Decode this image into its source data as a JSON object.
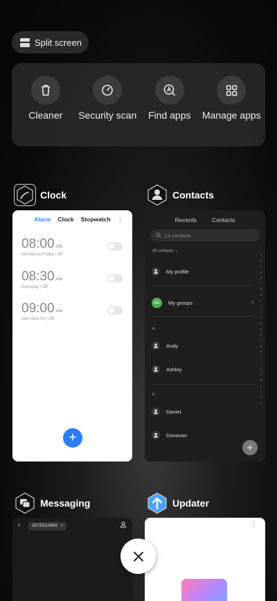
{
  "split_screen": {
    "label": "Split screen"
  },
  "quick_actions": [
    {
      "label": "Cleaner",
      "icon": "trash-icon"
    },
    {
      "label": "Security scan",
      "icon": "gauge-icon"
    },
    {
      "label": "Find apps",
      "icon": "find-apps-icon"
    },
    {
      "label": "Manage apps",
      "icon": "grid-icon"
    }
  ],
  "cards": {
    "clock": {
      "title": "Clock",
      "tabs": [
        "Alarm",
        "Clock",
        "Stopwatch"
      ],
      "alarms": [
        {
          "time": "08:00",
          "ampm": "AM",
          "desc": "Monday to Friday | Off"
        },
        {
          "time": "08:30",
          "ampm": "AM",
          "desc": "Everyday | Off"
        },
        {
          "time": "09:00",
          "ampm": "AM",
          "desc": "Mon Wed Fri | Off"
        }
      ]
    },
    "contacts": {
      "title": "Contacts",
      "tabs": [
        "Recents",
        "Contacts"
      ],
      "search_placeholder": "13 contacts",
      "all_contacts": "All contacts",
      "my_profile": "My profile",
      "my_groups": "My groups",
      "groups_badge": "MG",
      "section_a": "A",
      "section_d": "D",
      "contacts_a": [
        "Andy",
        "Ashley"
      ],
      "contacts_d": [
        "Daniel",
        "Donovan"
      ],
      "alphabet": "A B C D E F G H I J K L M N O P Q R S T U V W X Y Z #"
    },
    "messaging": {
      "title": "Messaging",
      "recipient": "18730218809"
    },
    "updater": {
      "title": "Updater"
    }
  },
  "colors": {
    "accent_blue": "#2b7ff2",
    "updater_icon": "#4aa3ff",
    "groups_green": "#4caf50"
  }
}
